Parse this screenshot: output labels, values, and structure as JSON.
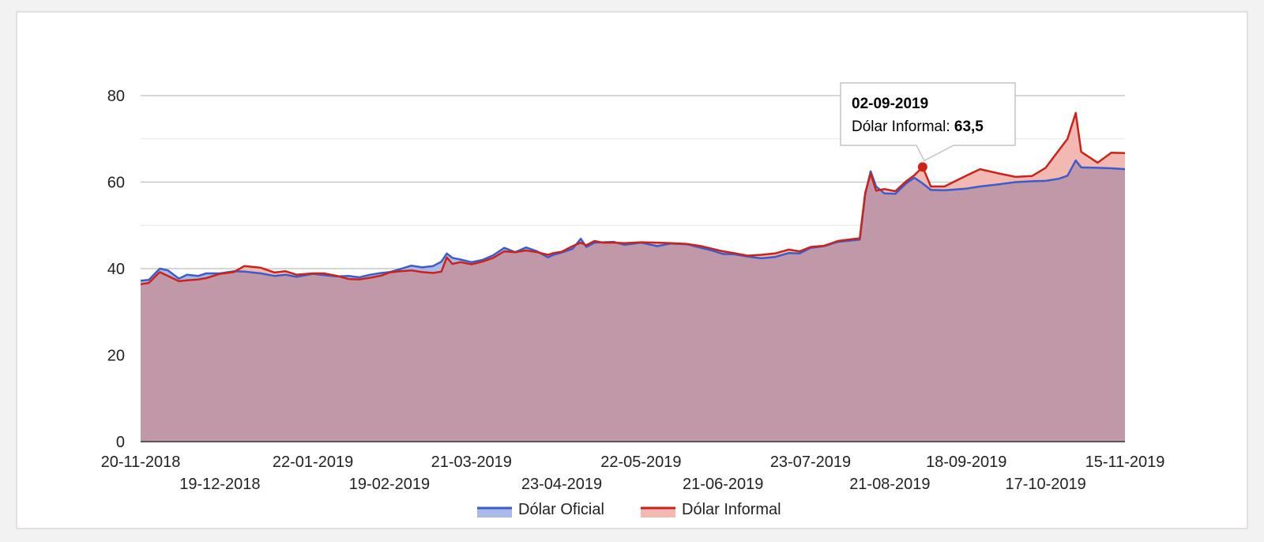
{
  "chart_data": {
    "type": "area",
    "title": "",
    "xlabel": "",
    "ylabel": "",
    "ylim": [
      0,
      80
    ],
    "grid": true,
    "legend_position": "bottom",
    "y_ticks": [
      "0",
      "20",
      "40",
      "60",
      "80"
    ],
    "x_ticks_row1": [
      "20-11-2018",
      "22-01-2019",
      "21-03-2019",
      "22-05-2019",
      "23-07-2019",
      "18-09-2019",
      "15-11-2019"
    ],
    "x_ticks_row2": [
      "19-12-2018",
      "19-02-2019",
      "23-04-2019",
      "21-06-2019",
      "21-08-2019",
      "17-10-2019"
    ],
    "x_range": [
      "20-11-2018",
      "15-11-2019"
    ],
    "colors": {
      "oficial_line": "#3a5ccc",
      "oficial_fill": "#aab9e8",
      "informal_line": "#cc2218",
      "informal_fill": "#f2b8b2",
      "overlap_fill": "#c198a8"
    },
    "series": [
      {
        "name": "Dólar Oficial",
        "points": [
          [
            "20-11-2018",
            37.2
          ],
          [
            "23-11-2018",
            37.4
          ],
          [
            "27-11-2018",
            40.0
          ],
          [
            "30-11-2018",
            39.6
          ],
          [
            "04-12-2018",
            37.7
          ],
          [
            "07-12-2018",
            38.6
          ],
          [
            "11-12-2018",
            38.3
          ],
          [
            "14-12-2018",
            38.9
          ],
          [
            "19-12-2018",
            38.9
          ],
          [
            "24-12-2018",
            39.4
          ],
          [
            "28-12-2018",
            39.3
          ],
          [
            "03-01-2019",
            38.9
          ],
          [
            "08-01-2019",
            38.3
          ],
          [
            "12-01-2019",
            38.6
          ],
          [
            "16-01-2019",
            38.1
          ],
          [
            "22-01-2019",
            38.8
          ],
          [
            "26-01-2019",
            38.5
          ],
          [
            "31-01-2019",
            38.2
          ],
          [
            "04-02-2019",
            38.3
          ],
          [
            "08-02-2019",
            38.0
          ],
          [
            "12-02-2019",
            38.6
          ],
          [
            "16-02-2019",
            39.0
          ],
          [
            "19-02-2019",
            39.2
          ],
          [
            "23-02-2019",
            39.9
          ],
          [
            "27-02-2019",
            40.7
          ],
          [
            "03-03-2019",
            40.3
          ],
          [
            "07-03-2019",
            40.6
          ],
          [
            "10-03-2019",
            41.6
          ],
          [
            "12-03-2019",
            43.5
          ],
          [
            "14-03-2019",
            42.5
          ],
          [
            "17-03-2019",
            42.1
          ],
          [
            "21-03-2019",
            41.5
          ],
          [
            "25-03-2019",
            42.0
          ],
          [
            "29-03-2019",
            43.1
          ],
          [
            "02-04-2019",
            44.8
          ],
          [
            "06-04-2019",
            43.8
          ],
          [
            "10-04-2019",
            44.9
          ],
          [
            "14-04-2019",
            44.0
          ],
          [
            "18-04-2019",
            42.6
          ],
          [
            "20-04-2019",
            43.2
          ],
          [
            "23-04-2019",
            43.7
          ],
          [
            "27-04-2019",
            44.6
          ],
          [
            "30-04-2019",
            46.9
          ],
          [
            "02-05-2019",
            45.0
          ],
          [
            "05-05-2019",
            46.0
          ],
          [
            "08-05-2019",
            46.1
          ],
          [
            "12-05-2019",
            46.2
          ],
          [
            "16-05-2019",
            45.5
          ],
          [
            "22-05-2019",
            46.0
          ],
          [
            "28-05-2019",
            45.2
          ],
          [
            "02-06-2019",
            45.8
          ],
          [
            "08-06-2019",
            45.6
          ],
          [
            "13-06-2019",
            44.8
          ],
          [
            "17-06-2019",
            44.2
          ],
          [
            "21-06-2019",
            43.4
          ],
          [
            "25-06-2019",
            43.3
          ],
          [
            "30-06-2019",
            42.8
          ],
          [
            "05-07-2019",
            42.4
          ],
          [
            "10-07-2019",
            42.7
          ],
          [
            "15-07-2019",
            43.6
          ],
          [
            "19-07-2019",
            43.5
          ],
          [
            "23-07-2019",
            44.8
          ],
          [
            "28-07-2019",
            45.2
          ],
          [
            "02-08-2019",
            46.2
          ],
          [
            "07-08-2019",
            46.5
          ],
          [
            "10-08-2019",
            46.7
          ],
          [
            "12-08-2019",
            57.2
          ],
          [
            "14-08-2019",
            62.5
          ],
          [
            "16-08-2019",
            59.0
          ],
          [
            "19-08-2019",
            57.4
          ],
          [
            "23-08-2019",
            57.3
          ],
          [
            "27-08-2019",
            59.7
          ],
          [
            "30-08-2019",
            61.0
          ],
          [
            "02-09-2019",
            59.7
          ],
          [
            "05-09-2019",
            58.2
          ],
          [
            "10-09-2019",
            58.1
          ],
          [
            "18-09-2019",
            58.5
          ],
          [
            "23-09-2019",
            59.0
          ],
          [
            "30-09-2019",
            59.5
          ],
          [
            "06-10-2019",
            60.0
          ],
          [
            "12-10-2019",
            60.2
          ],
          [
            "17-10-2019",
            60.3
          ],
          [
            "22-10-2019",
            60.8
          ],
          [
            "25-10-2019",
            61.5
          ],
          [
            "28-10-2019",
            65.0
          ],
          [
            "30-10-2019",
            63.4
          ],
          [
            "05-11-2019",
            63.3
          ],
          [
            "10-11-2019",
            63.2
          ],
          [
            "15-11-2019",
            63.0
          ]
        ]
      },
      {
        "name": "Dólar Informal",
        "points": [
          [
            "20-11-2018",
            36.4
          ],
          [
            "23-11-2018",
            36.7
          ],
          [
            "27-11-2018",
            39.2
          ],
          [
            "30-11-2018",
            38.3
          ],
          [
            "04-12-2018",
            37.1
          ],
          [
            "07-12-2018",
            37.3
          ],
          [
            "11-12-2018",
            37.5
          ],
          [
            "14-12-2018",
            37.8
          ],
          [
            "19-12-2018",
            38.8
          ],
          [
            "24-12-2018",
            39.2
          ],
          [
            "28-12-2018",
            40.6
          ],
          [
            "03-01-2019",
            40.2
          ],
          [
            "08-01-2019",
            39.1
          ],
          [
            "12-01-2019",
            39.4
          ],
          [
            "16-01-2019",
            38.6
          ],
          [
            "22-01-2019",
            38.9
          ],
          [
            "26-01-2019",
            38.9
          ],
          [
            "31-01-2019",
            38.3
          ],
          [
            "04-02-2019",
            37.6
          ],
          [
            "08-02-2019",
            37.5
          ],
          [
            "12-02-2019",
            37.9
          ],
          [
            "16-02-2019",
            38.4
          ],
          [
            "19-02-2019",
            39.1
          ],
          [
            "23-02-2019",
            39.4
          ],
          [
            "27-02-2019",
            39.6
          ],
          [
            "03-03-2019",
            39.2
          ],
          [
            "07-03-2019",
            39.0
          ],
          [
            "10-03-2019",
            39.3
          ],
          [
            "12-03-2019",
            42.6
          ],
          [
            "14-03-2019",
            41.1
          ],
          [
            "17-03-2019",
            41.5
          ],
          [
            "21-03-2019",
            41.0
          ],
          [
            "25-03-2019",
            41.6
          ],
          [
            "29-03-2019",
            42.5
          ],
          [
            "02-04-2019",
            44.0
          ],
          [
            "06-04-2019",
            43.8
          ],
          [
            "10-04-2019",
            44.2
          ],
          [
            "14-04-2019",
            43.8
          ],
          [
            "18-04-2019",
            43.2
          ],
          [
            "20-04-2019",
            43.6
          ],
          [
            "23-04-2019",
            43.9
          ],
          [
            "27-04-2019",
            45.2
          ],
          [
            "30-04-2019",
            46.0
          ],
          [
            "02-05-2019",
            45.4
          ],
          [
            "05-05-2019",
            46.4
          ],
          [
            "08-05-2019",
            46.0
          ],
          [
            "12-05-2019",
            46.0
          ],
          [
            "16-05-2019",
            45.9
          ],
          [
            "22-05-2019",
            46.1
          ],
          [
            "28-05-2019",
            46.0
          ],
          [
            "02-06-2019",
            45.9
          ],
          [
            "08-06-2019",
            45.7
          ],
          [
            "13-06-2019",
            45.2
          ],
          [
            "17-06-2019",
            44.6
          ],
          [
            "21-06-2019",
            44.0
          ],
          [
            "25-06-2019",
            43.6
          ],
          [
            "30-06-2019",
            43.0
          ],
          [
            "05-07-2019",
            43.2
          ],
          [
            "10-07-2019",
            43.5
          ],
          [
            "15-07-2019",
            44.4
          ],
          [
            "19-07-2019",
            44.0
          ],
          [
            "23-07-2019",
            45.0
          ],
          [
            "28-07-2019",
            45.3
          ],
          [
            "02-08-2019",
            46.4
          ],
          [
            "07-08-2019",
            46.8
          ],
          [
            "10-08-2019",
            47.0
          ],
          [
            "12-08-2019",
            57.5
          ],
          [
            "14-08-2019",
            62.0
          ],
          [
            "16-08-2019",
            58.0
          ],
          [
            "19-08-2019",
            58.4
          ],
          [
            "23-08-2019",
            57.9
          ],
          [
            "27-08-2019",
            60.2
          ],
          [
            "30-08-2019",
            61.6
          ],
          [
            "02-09-2019",
            63.5
          ],
          [
            "05-09-2019",
            59.0
          ],
          [
            "10-09-2019",
            59.0
          ],
          [
            "18-09-2019",
            61.5
          ],
          [
            "23-09-2019",
            63.0
          ],
          [
            "30-09-2019",
            62.0
          ],
          [
            "06-10-2019",
            61.2
          ],
          [
            "12-10-2019",
            61.4
          ],
          [
            "17-10-2019",
            63.3
          ],
          [
            "22-10-2019",
            67.5
          ],
          [
            "25-10-2019",
            70.0
          ],
          [
            "28-10-2019",
            76.0
          ],
          [
            "30-10-2019",
            67.0
          ],
          [
            "05-11-2019",
            64.5
          ],
          [
            "10-11-2019",
            66.8
          ],
          [
            "15-11-2019",
            66.7
          ]
        ]
      }
    ],
    "tooltip": {
      "date": "02-09-2019",
      "series_label": "Dólar Informal:",
      "value_label": "63,5",
      "value": 63.5
    }
  }
}
